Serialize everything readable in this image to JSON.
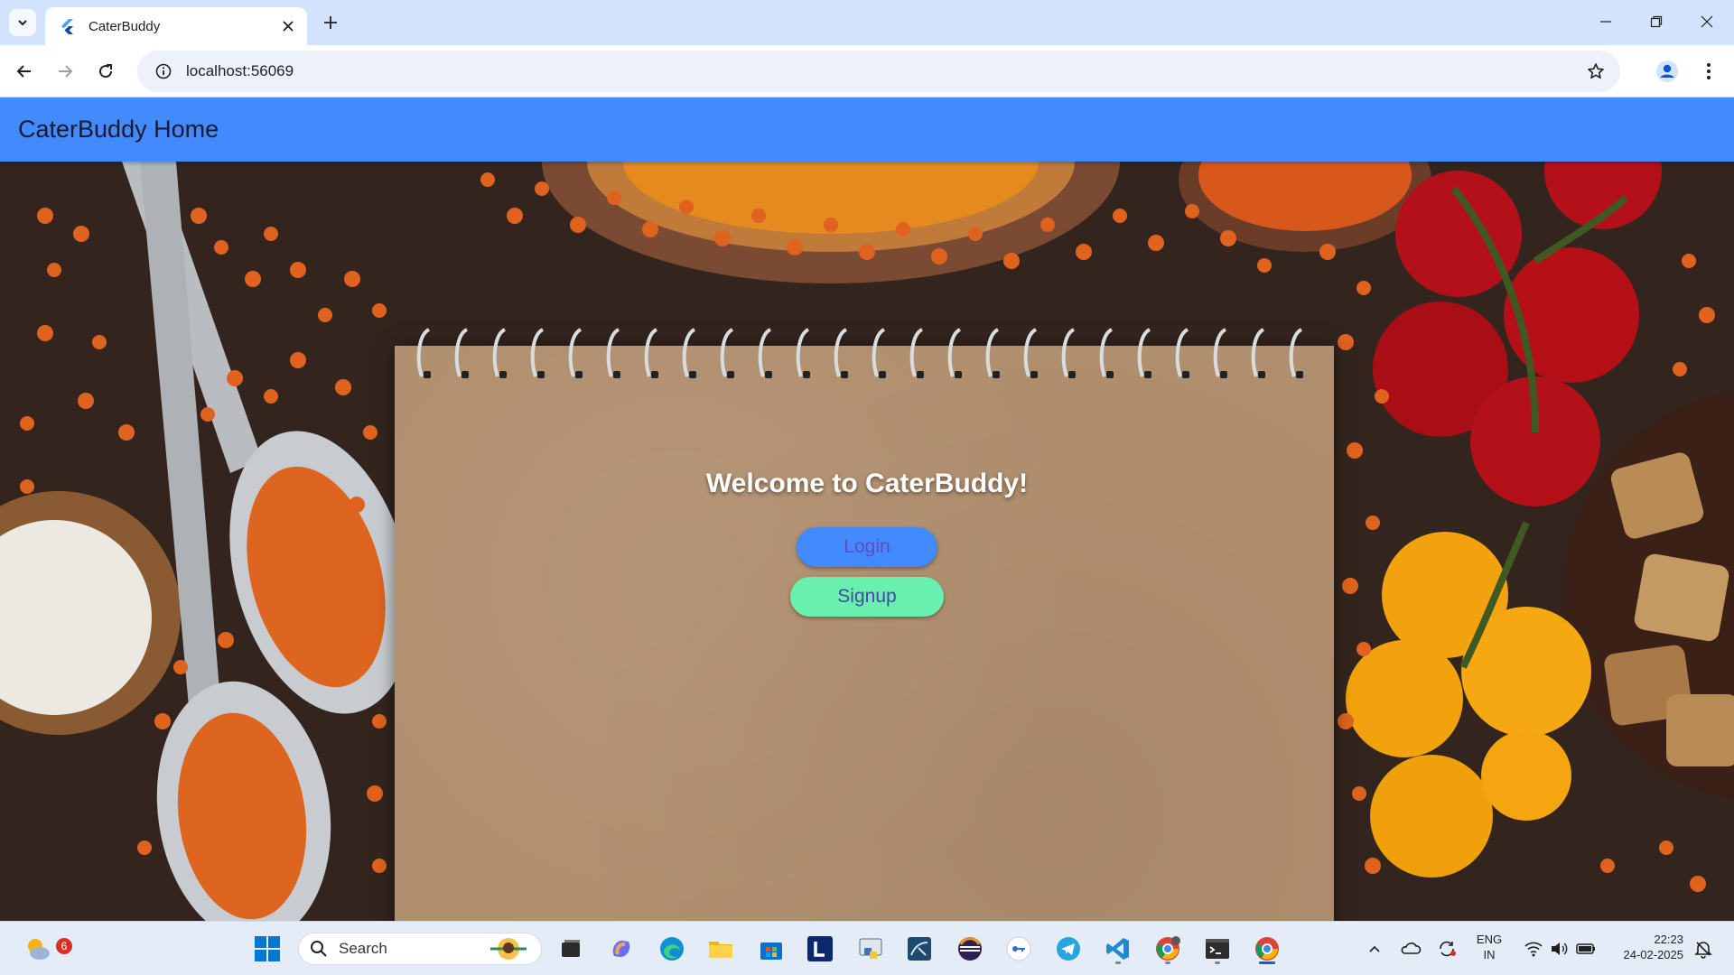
{
  "browser": {
    "tab_title": "CaterBuddy",
    "url": "localhost:56069"
  },
  "app": {
    "appbar_title": "CaterBuddy Home",
    "welcome": "Welcome to CaterBuddy!",
    "login_label": "Login",
    "signup_label": "Signup",
    "colors": {
      "appbar": "#448aff",
      "login_button": "#448aff",
      "signup_button": "#69f0ae"
    }
  },
  "taskbar": {
    "search_label": "Search",
    "weather_badge": "6",
    "language": "ENG",
    "region": "IN",
    "time": "22:23",
    "date": "24-02-2025",
    "pinned_icons": [
      "windows-start-icon",
      "task-view-icon",
      "copilot-icon",
      "edge-icon",
      "file-explorer-icon",
      "microsoft-store-icon",
      "l-app-icon",
      "python-idle-icon",
      "mysql-workbench-icon",
      "eclipse-icon",
      "key-app-icon",
      "telegram-icon",
      "vscode-icon",
      "chrome-profile-icon",
      "terminal-icon",
      "chrome-icon"
    ]
  }
}
